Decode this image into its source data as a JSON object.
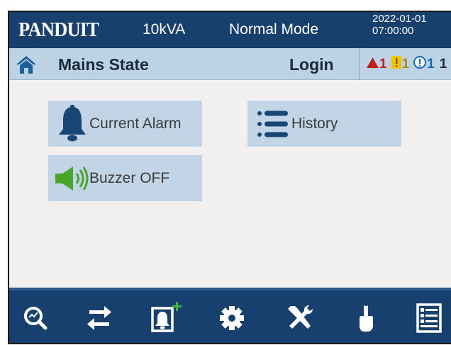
{
  "header": {
    "brand": "PANDUIT",
    "capacity": "10kVA",
    "mode": "Normal Mode",
    "date": "2022-01-01",
    "time": "07:00:00"
  },
  "state_bar": {
    "title": "Mains State",
    "login_label": "Login",
    "alarm_counts": {
      "critical": "1",
      "major": "1",
      "minor": "1",
      "extra": "1"
    }
  },
  "main": {
    "current_alarm_label": "Current Alarm",
    "history_label": "History",
    "buzzer_label": "Buzzer OFF"
  },
  "toolbar": {
    "items": [
      {
        "icon": "search-icon"
      },
      {
        "icon": "swap-arrows-icon"
      },
      {
        "icon": "alarm-add-icon"
      },
      {
        "icon": "gear-icon"
      },
      {
        "icon": "tools-icon"
      },
      {
        "icon": "touch-hand-icon"
      },
      {
        "icon": "log-document-icon"
      }
    ]
  },
  "colors": {
    "header_bg": "#18406f",
    "state_bar_bg": "#bcd3e6",
    "tile_bg": "#c2d5e6",
    "page_bg": "#f1f0ee",
    "alarm_red": "#c21d1d",
    "warning_yellow": "#f2c400",
    "info_blue": "#1566b7",
    "buzzer_green": "#4aa52d"
  }
}
